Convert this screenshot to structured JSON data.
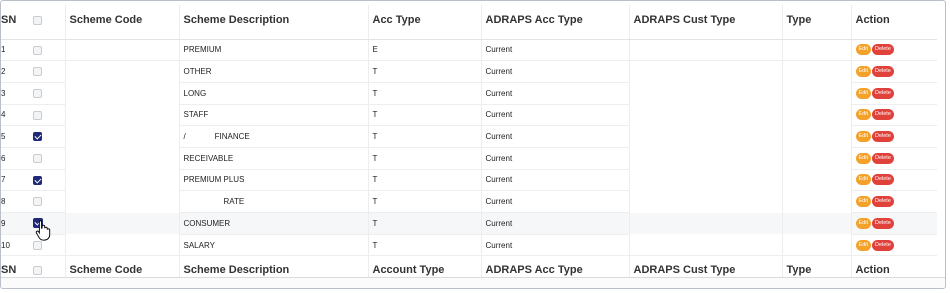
{
  "header": {
    "sn": "SN",
    "scheme_code": "Scheme Code",
    "scheme_description": "Scheme Description",
    "acc_type": "Acc Type",
    "adraps_acc_type": "ADRAPS Acc Type",
    "adraps_cust_type": "ADRAPS Cust Type",
    "type": "Type",
    "action": "Action"
  },
  "footer": {
    "sn": "SN",
    "scheme_code": "Scheme Code",
    "scheme_description": "Scheme Description",
    "acc_type": "Account Type",
    "adraps_acc_type": "ADRAPS Acc Type",
    "adraps_cust_type": "ADRAPS Cust Type",
    "type": "Type",
    "action": "Action"
  },
  "buttons": {
    "edit": "Edit",
    "delete": "Delete"
  },
  "colors": {
    "edit": "#f4a12a",
    "delete": "#e0413b",
    "checkbox_checked": "#1e2a78"
  },
  "rows": [
    {
      "sn": "1",
      "checked": false,
      "scheme_code": "",
      "description": "PREMIUM",
      "acc_type": "E",
      "adraps_acc_type": "Current",
      "adraps_cust_type": "",
      "type": ""
    },
    {
      "sn": "2",
      "checked": false,
      "scheme_code": "",
      "description": "OTHER",
      "acc_type": "T",
      "adraps_acc_type": "Current",
      "adraps_cust_type": "",
      "type": ""
    },
    {
      "sn": "3",
      "checked": false,
      "scheme_code": "",
      "description": "LONG",
      "acc_type": "T",
      "adraps_acc_type": "Current",
      "adraps_cust_type": "",
      "type": ""
    },
    {
      "sn": "4",
      "checked": false,
      "scheme_code": "",
      "description": "STAFF",
      "acc_type": "T",
      "adraps_acc_type": "Current",
      "adraps_cust_type": "",
      "type": ""
    },
    {
      "sn": "5",
      "checked": true,
      "scheme_code": "",
      "description": "/             FINANCE",
      "acc_type": "T",
      "adraps_acc_type": "Current",
      "adraps_cust_type": "",
      "type": ""
    },
    {
      "sn": "6",
      "checked": false,
      "scheme_code": "",
      "description": "RECEIVABLE",
      "acc_type": "T",
      "adraps_acc_type": "Current",
      "adraps_cust_type": "",
      "type": ""
    },
    {
      "sn": "7",
      "checked": true,
      "scheme_code": "",
      "description": "PREMIUM PLUS",
      "acc_type": "T",
      "adraps_acc_type": "Current",
      "adraps_cust_type": "",
      "type": ""
    },
    {
      "sn": "8",
      "checked": false,
      "scheme_code": "",
      "description": "                  RATE",
      "acc_type": "T",
      "adraps_acc_type": "Current",
      "adraps_cust_type": "",
      "type": ""
    },
    {
      "sn": "9",
      "checked": true,
      "scheme_code": "",
      "description": "CONSUMER",
      "acc_type": "T",
      "adraps_acc_type": "Current",
      "adraps_cust_type": "",
      "type": ""
    },
    {
      "sn": "10",
      "checked": false,
      "scheme_code": "",
      "description": "SALARY",
      "acc_type": "T",
      "adraps_acc_type": "Current",
      "adraps_cust_type": "",
      "type": ""
    }
  ]
}
